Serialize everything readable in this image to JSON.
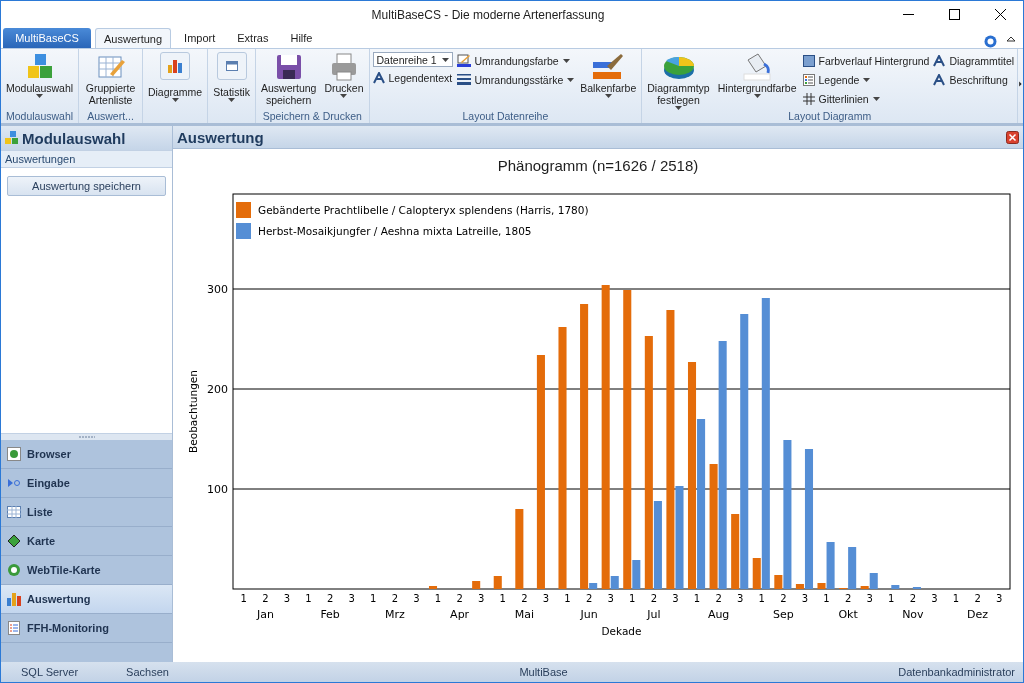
{
  "window": {
    "title": "MultiBaseCS - Die moderne Artenerfassung"
  },
  "app_button": {
    "label": "MultiBaseCS"
  },
  "tabs": [
    {
      "label": "Auswertung",
      "selected": true
    },
    {
      "label": "Import",
      "selected": false
    },
    {
      "label": "Extras",
      "selected": false
    },
    {
      "label": "Hilfe",
      "selected": false
    }
  ],
  "ribbon": [
    {
      "label": "Modulauswahl",
      "items": [
        {
          "kind": "large",
          "label": "Modulauswahl",
          "dropdown": true
        }
      ]
    },
    {
      "label": "Auswert...",
      "items": [
        {
          "kind": "large",
          "label": "Gruppierte Artenliste",
          "dropdown": false
        }
      ]
    },
    {
      "items": [
        {
          "kind": "boxed",
          "label": "Diagramme",
          "dropdown": true
        }
      ]
    },
    {
      "items": [
        {
          "kind": "boxed",
          "label": "Statistik",
          "dropdown": true
        }
      ]
    },
    {
      "label": "Speichern & Drucken",
      "items": [
        {
          "kind": "large",
          "label": "Auswertung speichern",
          "dropdown": false
        },
        {
          "kind": "large",
          "label": "Drucken",
          "dropdown": true
        }
      ]
    },
    {
      "label": "Layout Datenreihe",
      "items": [
        {
          "kind": "stack",
          "items": [
            {
              "kind": "select",
              "value": "Datenreihe 1"
            },
            {
              "kind": "small",
              "label": "Legendentext",
              "dropdown": false
            }
          ]
        },
        {
          "kind": "stack",
          "items": [
            {
              "kind": "small",
              "label": "Umrandungsfarbe",
              "dropdown": true
            },
            {
              "kind": "small",
              "label": "Umrandungsstärke",
              "dropdown": true
            }
          ]
        },
        {
          "kind": "large",
          "label": "Balkenfarbe",
          "dropdown": true
        }
      ]
    },
    {
      "label": "Layout Diagramm",
      "items": [
        {
          "kind": "large",
          "label": "Diagrammtyp festlegen",
          "dropdown": true
        },
        {
          "kind": "large",
          "label": "Hintergrundfarbe",
          "dropdown": true
        },
        {
          "kind": "stack",
          "items": [
            {
              "kind": "small",
              "label": "Farbverlauf Hintergrund",
              "dropdown": false
            },
            {
              "kind": "small",
              "label": "Legende",
              "dropdown": true
            },
            {
              "kind": "small",
              "label": "Gitterlinien",
              "dropdown": true
            }
          ]
        },
        {
          "kind": "stack",
          "items": [
            {
              "kind": "small",
              "label": "Diagrammtitel",
              "dropdown": false
            },
            {
              "kind": "small",
              "label": "Beschriftung",
              "dropdown": false
            }
          ]
        }
      ]
    }
  ],
  "sidebar": {
    "title": "Modulauswahl",
    "section": "Auswertungen",
    "button": "Auswertung speichern",
    "items": [
      {
        "label": "Browser",
        "selected": false
      },
      {
        "label": "Eingabe",
        "selected": false
      },
      {
        "label": "Liste",
        "selected": false
      },
      {
        "label": "Karte",
        "selected": false
      },
      {
        "label": "WebTile-Karte",
        "selected": false
      },
      {
        "label": "Auswertung",
        "selected": true
      },
      {
        "label": "FFH-Monitoring",
        "selected": false
      }
    ]
  },
  "panel": {
    "title": "Auswertung",
    "month_labels": [
      "Jan",
      "Feb",
      "Mrz",
      "Apr",
      "Mai",
      "Jun",
      "Jul",
      "Aug",
      "Sep",
      "Okt",
      "Nov",
      "Dez"
    ],
    "chart_data": {
      "type": "bar",
      "title": "Phänogramm (n=1626 / 2518)",
      "xlabel": "Dekade",
      "ylabel": "Beobachtungen",
      "categories": [
        "1",
        "2",
        "3",
        "1",
        "2",
        "3",
        "1",
        "2",
        "3",
        "1",
        "2",
        "3",
        "1",
        "2",
        "3",
        "1",
        "2",
        "3",
        "1",
        "2",
        "3",
        "1",
        "2",
        "3",
        "1",
        "2",
        "3",
        "1",
        "2",
        "3",
        "1",
        "2",
        "3",
        "1",
        "2",
        "3"
      ],
      "grid": true,
      "legend": true,
      "series": [
        {
          "name": "Gebänderte Prachtlibelle / Calopteryx splendens (Harris, 1780)",
          "color": "#e46c0a",
          "values": [
            0,
            0,
            0,
            0,
            0,
            0,
            0,
            0,
            0,
            3,
            0,
            8,
            13,
            80,
            234,
            262,
            285,
            304,
            299,
            253,
            279,
            227,
            125,
            75,
            31,
            14,
            5,
            6,
            1,
            3,
            0,
            0,
            0,
            0,
            0,
            0
          ]
        },
        {
          "name": "Herbst-Mosaikjungfer / Aeshna mixta Latreille, 1805",
          "color": "#558ed5",
          "values": [
            0,
            0,
            0,
            0,
            0,
            0,
            0,
            0,
            0,
            0,
            0,
            0,
            0,
            0,
            0,
            0,
            6,
            13,
            29,
            88,
            103,
            170,
            248,
            275,
            291,
            149,
            140,
            47,
            42,
            16,
            4,
            2,
            0,
            0,
            0,
            0
          ]
        }
      ],
      "ylim": [
        0,
        395
      ],
      "yticks": [
        100,
        200,
        300
      ]
    }
  },
  "status_bar": [
    "SQL Server",
    "Sachsen",
    "MultiBase",
    "Datenbankadministrator"
  ]
}
